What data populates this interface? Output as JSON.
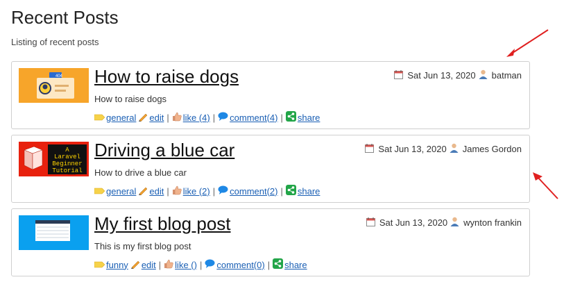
{
  "page": {
    "title": "Recent Posts",
    "subtitle": "Listing of recent posts"
  },
  "posts": [
    {
      "title": "How to raise dogs",
      "description": "How to raise dogs",
      "date": "Sat Jun 13, 2020",
      "author": "batman",
      "tag": " general",
      "edit": " edit",
      "like": " like (4)",
      "comment": " comment(4)",
      "share": " share",
      "thumb_text": "404",
      "thumb_color": "#f5a623"
    },
    {
      "title": "Driving a blue car",
      "description": "How to drive a blue car",
      "date": "Sat Jun 13, 2020",
      "author": "James Gordon",
      "tag": " general",
      "edit": " edit",
      "like": " like (2)",
      "comment": " comment(2)",
      "share": " share",
      "thumb_text": "A Laravel Beginner Tutorial",
      "thumb_color": "#e8210e"
    },
    {
      "title": "My first blog post",
      "description": "This is my first blog post",
      "date": "Sat Jun 13, 2020",
      "author": "wynton frankin",
      "tag": " funny",
      "edit": " edit",
      "like": " like ()",
      "comment": " comment(0)",
      "share": " share",
      "thumb_color": "#0aa0ef"
    }
  ],
  "colors": {
    "link": "#1a5fb4",
    "annotation_arrow": "#e02020",
    "share_icon": "#22a548",
    "comment_icon": "#1e88e5"
  },
  "icons": [
    "calendar-icon",
    "user-icon",
    "tag-icon",
    "pencil-icon",
    "thumbs-up-icon",
    "comment-icon",
    "share-icon"
  ]
}
